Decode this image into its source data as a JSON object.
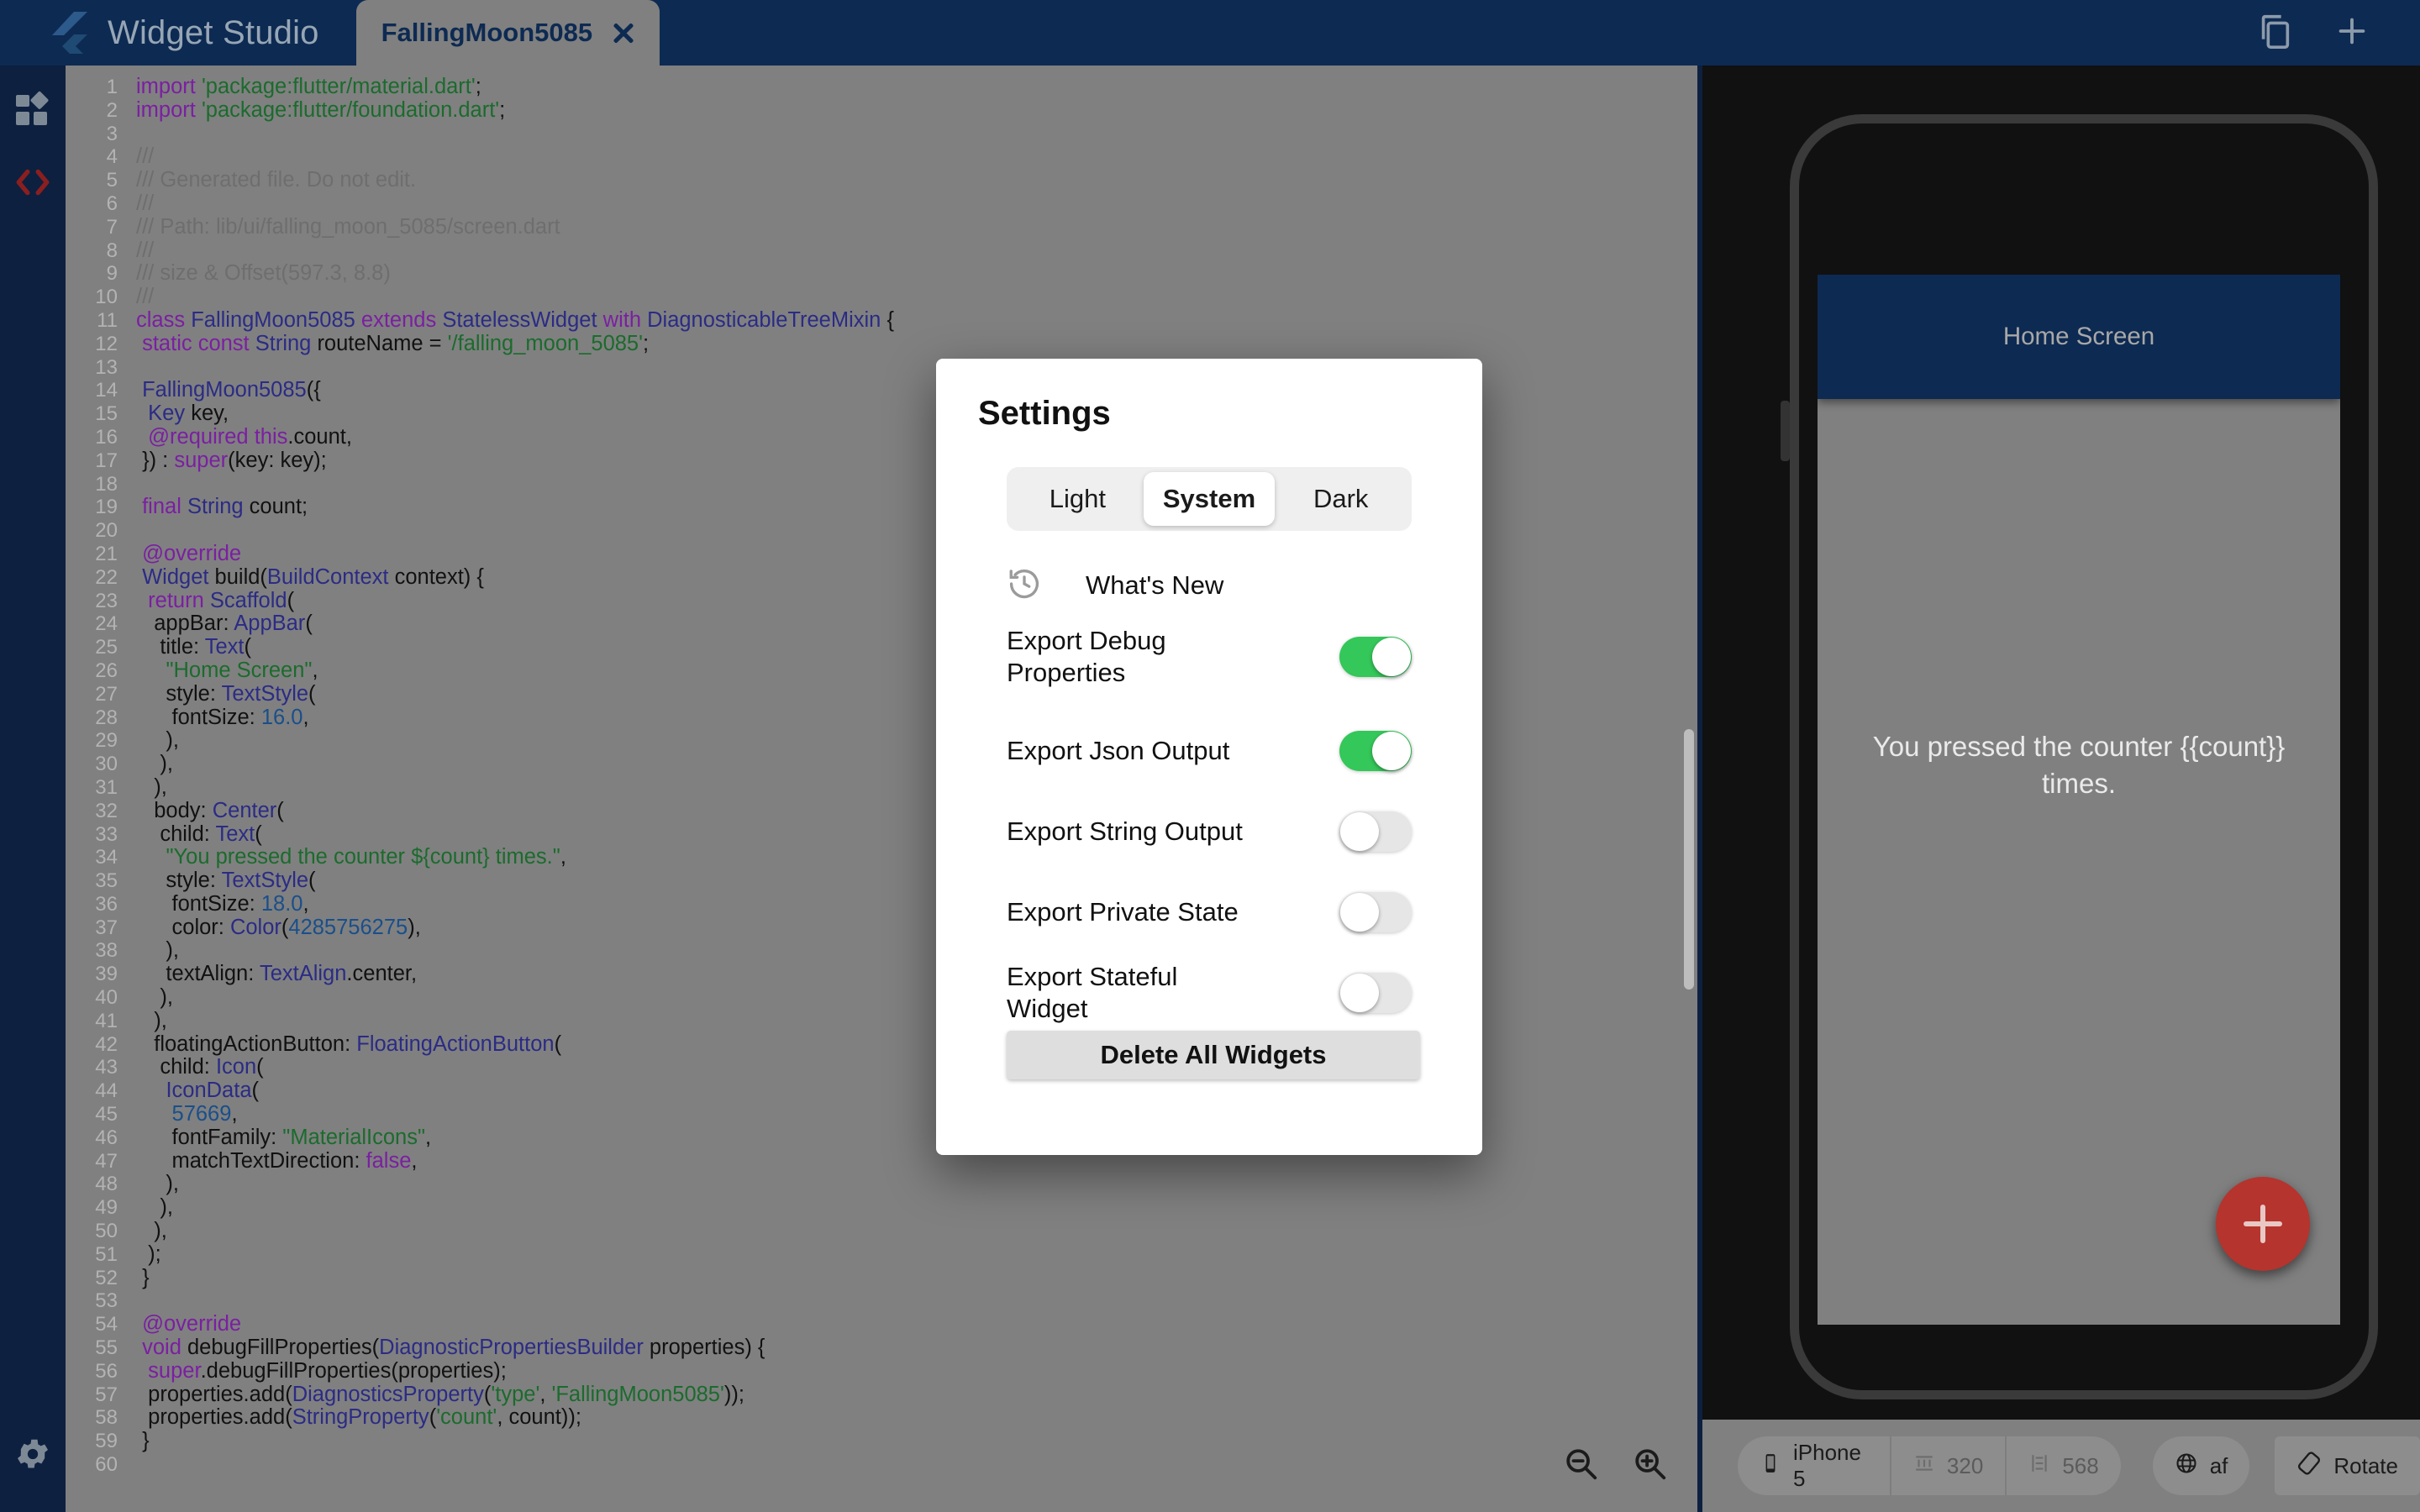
{
  "titlebar": {
    "app_name": "Widget Studio",
    "logo_icon": "flutter-logo-icon",
    "tab": {
      "label": "FallingMoon5085",
      "close_icon": "close-icon"
    },
    "actions": [
      {
        "name": "duplicate-button",
        "icon": "copy-icon"
      },
      {
        "name": "new-widget-button",
        "icon": "plus-icon"
      }
    ]
  },
  "sidebar": {
    "items": [
      {
        "name": "sidebar-item-widgets",
        "icon": "widgets-grid-icon",
        "active": false
      },
      {
        "name": "sidebar-item-code",
        "icon": "code-brackets-icon",
        "active": true
      }
    ],
    "bottom": {
      "name": "sidebar-item-settings",
      "icon": "gear-icon"
    }
  },
  "editor": {
    "zoom_out_icon": "zoom-out-icon",
    "zoom_in_icon": "zoom-in-icon",
    "lines": [
      {
        "n": 1,
        "tokens": [
          [
            "kw",
            "import "
          ],
          [
            "str",
            "'package:flutter/material.dart'"
          ],
          [
            "ct",
            ";"
          ]
        ]
      },
      {
        "n": 2,
        "tokens": [
          [
            "kw",
            "import "
          ],
          [
            "str",
            "'package:flutter/foundation.dart'"
          ],
          [
            "ct",
            ";"
          ]
        ]
      },
      {
        "n": 3,
        "tokens": []
      },
      {
        "n": 4,
        "tokens": [
          [
            "cmt",
            "///"
          ]
        ]
      },
      {
        "n": 5,
        "tokens": [
          [
            "cmt",
            "/// Generated file. Do not edit."
          ]
        ]
      },
      {
        "n": 6,
        "tokens": [
          [
            "cmt",
            "///"
          ]
        ]
      },
      {
        "n": 7,
        "tokens": [
          [
            "cmt",
            "/// Path: lib/ui/falling_moon_5085/screen.dart"
          ]
        ]
      },
      {
        "n": 8,
        "tokens": [
          [
            "cmt",
            "///"
          ]
        ]
      },
      {
        "n": 9,
        "tokens": [
          [
            "cmt",
            "/// size & Offset(597.3, 8.8)"
          ]
        ]
      },
      {
        "n": 10,
        "tokens": [
          [
            "cmt",
            "///"
          ]
        ]
      },
      {
        "n": 11,
        "tokens": [
          [
            "kw",
            "class "
          ],
          [
            "typ",
            "FallingMoon5085"
          ],
          [
            "kw",
            " extends "
          ],
          [
            "typ",
            "StatelessWidget"
          ],
          [
            "kw",
            " with "
          ],
          [
            "typ",
            "DiagnosticableTreeMixin"
          ],
          [
            "ct",
            " {"
          ]
        ]
      },
      {
        "n": 12,
        "tokens": [
          [
            "ct",
            " "
          ],
          [
            "kw",
            "static const "
          ],
          [
            "typ",
            "String "
          ],
          [
            "ct",
            "routeName = "
          ],
          [
            "str",
            "'/falling_moon_5085'"
          ],
          [
            "ct",
            ";"
          ]
        ]
      },
      {
        "n": 13,
        "tokens": []
      },
      {
        "n": 14,
        "tokens": [
          [
            "ct",
            " "
          ],
          [
            "typ",
            "FallingMoon5085"
          ],
          [
            "ct",
            "({"
          ]
        ]
      },
      {
        "n": 15,
        "tokens": [
          [
            "ct",
            "  "
          ],
          [
            "typ",
            "Key "
          ],
          [
            "ct",
            "key,"
          ]
        ]
      },
      {
        "n": 16,
        "tokens": [
          [
            "ct",
            "  "
          ],
          [
            "kw",
            "@required this"
          ],
          [
            "ct",
            ".count,"
          ]
        ]
      },
      {
        "n": 17,
        "tokens": [
          [
            "ct",
            " }) : "
          ],
          [
            "kw",
            "super"
          ],
          [
            "ct",
            "(key: key);"
          ]
        ]
      },
      {
        "n": 18,
        "tokens": []
      },
      {
        "n": 19,
        "tokens": [
          [
            "ct",
            " "
          ],
          [
            "kw",
            "final "
          ],
          [
            "typ",
            "String "
          ],
          [
            "ct",
            "count;"
          ]
        ]
      },
      {
        "n": 20,
        "tokens": []
      },
      {
        "n": 21,
        "tokens": [
          [
            "ct",
            " "
          ],
          [
            "kw",
            "@override"
          ]
        ]
      },
      {
        "n": 22,
        "tokens": [
          [
            "ct",
            " "
          ],
          [
            "typ",
            "Widget "
          ],
          [
            "ct",
            "build("
          ],
          [
            "typ",
            "BuildContext "
          ],
          [
            "ct",
            "context) {"
          ]
        ]
      },
      {
        "n": 23,
        "tokens": [
          [
            "ct",
            "  "
          ],
          [
            "kw",
            "return "
          ],
          [
            "typ",
            "Scaffold"
          ],
          [
            "ct",
            "("
          ]
        ]
      },
      {
        "n": 24,
        "tokens": [
          [
            "ct",
            "   appBar: "
          ],
          [
            "typ",
            "AppBar"
          ],
          [
            "ct",
            "("
          ]
        ]
      },
      {
        "n": 25,
        "tokens": [
          [
            "ct",
            "    title: "
          ],
          [
            "typ",
            "Text"
          ],
          [
            "ct",
            "("
          ]
        ]
      },
      {
        "n": 26,
        "tokens": [
          [
            "ct",
            "     "
          ],
          [
            "str",
            "\"Home Screen\""
          ],
          [
            "ct",
            ","
          ]
        ]
      },
      {
        "n": 27,
        "tokens": [
          [
            "ct",
            "     style: "
          ],
          [
            "typ",
            "TextStyle"
          ],
          [
            "ct",
            "("
          ]
        ]
      },
      {
        "n": 28,
        "tokens": [
          [
            "ct",
            "      fontSize: "
          ],
          [
            "num",
            "16.0"
          ],
          [
            "ct",
            ","
          ]
        ]
      },
      {
        "n": 29,
        "tokens": [
          [
            "ct",
            "     ),"
          ]
        ]
      },
      {
        "n": 30,
        "tokens": [
          [
            "ct",
            "    ),"
          ]
        ]
      },
      {
        "n": 31,
        "tokens": [
          [
            "ct",
            "   ),"
          ]
        ]
      },
      {
        "n": 32,
        "tokens": [
          [
            "ct",
            "   body: "
          ],
          [
            "typ",
            "Center"
          ],
          [
            "ct",
            "("
          ]
        ]
      },
      {
        "n": 33,
        "tokens": [
          [
            "ct",
            "    child: "
          ],
          [
            "typ",
            "Text"
          ],
          [
            "ct",
            "("
          ]
        ]
      },
      {
        "n": 34,
        "tokens": [
          [
            "ct",
            "     "
          ],
          [
            "str",
            "\"You pressed the counter ${count} times.\""
          ],
          [
            "ct",
            ","
          ]
        ]
      },
      {
        "n": 35,
        "tokens": [
          [
            "ct",
            "     style: "
          ],
          [
            "typ",
            "TextStyle"
          ],
          [
            "ct",
            "("
          ]
        ]
      },
      {
        "n": 36,
        "tokens": [
          [
            "ct",
            "      fontSize: "
          ],
          [
            "num",
            "18.0"
          ],
          [
            "ct",
            ","
          ]
        ]
      },
      {
        "n": 37,
        "tokens": [
          [
            "ct",
            "      color: "
          ],
          [
            "typ",
            "Color"
          ],
          [
            "ct",
            "("
          ],
          [
            "num",
            "4285756275"
          ],
          [
            "ct",
            "),"
          ]
        ]
      },
      {
        "n": 38,
        "tokens": [
          [
            "ct",
            "     ),"
          ]
        ]
      },
      {
        "n": 39,
        "tokens": [
          [
            "ct",
            "     textAlign: "
          ],
          [
            "typ",
            "TextAlign"
          ],
          [
            "ct",
            ".center,"
          ]
        ]
      },
      {
        "n": 40,
        "tokens": [
          [
            "ct",
            "    ),"
          ]
        ]
      },
      {
        "n": 41,
        "tokens": [
          [
            "ct",
            "   ),"
          ]
        ]
      },
      {
        "n": 42,
        "tokens": [
          [
            "ct",
            "   floatingActionButton: "
          ],
          [
            "typ",
            "FloatingActionButton"
          ],
          [
            "ct",
            "("
          ]
        ]
      },
      {
        "n": 43,
        "tokens": [
          [
            "ct",
            "    child: "
          ],
          [
            "typ",
            "Icon"
          ],
          [
            "ct",
            "("
          ]
        ]
      },
      {
        "n": 44,
        "tokens": [
          [
            "ct",
            "     "
          ],
          [
            "typ",
            "IconData"
          ],
          [
            "ct",
            "("
          ]
        ]
      },
      {
        "n": 45,
        "tokens": [
          [
            "ct",
            "      "
          ],
          [
            "num",
            "57669"
          ],
          [
            "ct",
            ","
          ]
        ]
      },
      {
        "n": 46,
        "tokens": [
          [
            "ct",
            "      fontFamily: "
          ],
          [
            "str",
            "\"MaterialIcons\""
          ],
          [
            "ct",
            ","
          ]
        ]
      },
      {
        "n": 47,
        "tokens": [
          [
            "ct",
            "      matchTextDirection: "
          ],
          [
            "kw",
            "false"
          ],
          [
            "ct",
            ","
          ]
        ]
      },
      {
        "n": 48,
        "tokens": [
          [
            "ct",
            "     ),"
          ]
        ]
      },
      {
        "n": 49,
        "tokens": [
          [
            "ct",
            "    ),"
          ]
        ]
      },
      {
        "n": 50,
        "tokens": [
          [
            "ct",
            "   ),"
          ]
        ]
      },
      {
        "n": 51,
        "tokens": [
          [
            "ct",
            "  );"
          ]
        ]
      },
      {
        "n": 52,
        "tokens": [
          [
            "ct",
            " }"
          ]
        ]
      },
      {
        "n": 53,
        "tokens": []
      },
      {
        "n": 54,
        "tokens": [
          [
            "ct",
            " "
          ],
          [
            "kw",
            "@override"
          ]
        ]
      },
      {
        "n": 55,
        "tokens": [
          [
            "ct",
            " "
          ],
          [
            "kw",
            "void "
          ],
          [
            "ct",
            "debugFillProperties("
          ],
          [
            "typ",
            "DiagnosticPropertiesBuilder "
          ],
          [
            "ct",
            "properties) {"
          ]
        ]
      },
      {
        "n": 56,
        "tokens": [
          [
            "ct",
            "  "
          ],
          [
            "kw",
            "super"
          ],
          [
            "ct",
            ".debugFillProperties(properties);"
          ]
        ]
      },
      {
        "n": 57,
        "tokens": [
          [
            "ct",
            "  properties.add("
          ],
          [
            "typ",
            "DiagnosticsProperty"
          ],
          [
            "ct",
            "("
          ],
          [
            "str",
            "'type'"
          ],
          [
            "ct",
            ", "
          ],
          [
            "str",
            "'FallingMoon5085'"
          ],
          [
            "ct",
            "));"
          ]
        ]
      },
      {
        "n": 58,
        "tokens": [
          [
            "ct",
            "  properties.add("
          ],
          [
            "typ",
            "StringProperty"
          ],
          [
            "ct",
            "("
          ],
          [
            "str",
            "'count'"
          ],
          [
            "ct",
            ", count));"
          ]
        ]
      },
      {
        "n": 59,
        "tokens": [
          [
            "ct",
            " }"
          ]
        ]
      },
      {
        "n": 60,
        "tokens": []
      }
    ]
  },
  "preview": {
    "appbar_title": "Home Screen",
    "body_text": "You pressed the counter {{count}} times.",
    "fab_icon": "plus-icon",
    "devbar": [
      {
        "name": "device-selector",
        "icon": "phone-icon",
        "label": "iPhone 5"
      },
      {
        "name": "width-field",
        "icon": "width-ruler-icon",
        "label": "320"
      },
      {
        "name": "height-field",
        "icon": "height-ruler-icon",
        "label": "568"
      },
      {
        "name": "locale-selector",
        "icon": "globe-icon",
        "label": "af"
      },
      {
        "name": "rotate-button",
        "icon": "rotate-icon",
        "label": "Rotate"
      }
    ]
  },
  "dialog": {
    "title": "Settings",
    "theme_options": [
      {
        "label": "Light",
        "active": false
      },
      {
        "label": "System",
        "active": true
      },
      {
        "label": "Dark",
        "active": false
      }
    ],
    "whats_new": {
      "label": "What's New",
      "icon": "history-restore-icon"
    },
    "settings": [
      {
        "label": "Export Debug Properties",
        "state": "on"
      },
      {
        "label": "Export Json Output",
        "state": "on"
      },
      {
        "label": "Export String Output",
        "state": "off"
      },
      {
        "label": "Export Private State",
        "state": "off"
      },
      {
        "label": "Export Stateful Widget",
        "state": "off"
      }
    ],
    "delete_button": "Delete All Widgets"
  },
  "colors": {
    "chrome": "#0d2a52",
    "rail": "#0d2040",
    "editor_bg": "#808080",
    "toggle_on": "#34c759",
    "fab": "#b5342e",
    "accent_code": "#8b1f1f"
  }
}
